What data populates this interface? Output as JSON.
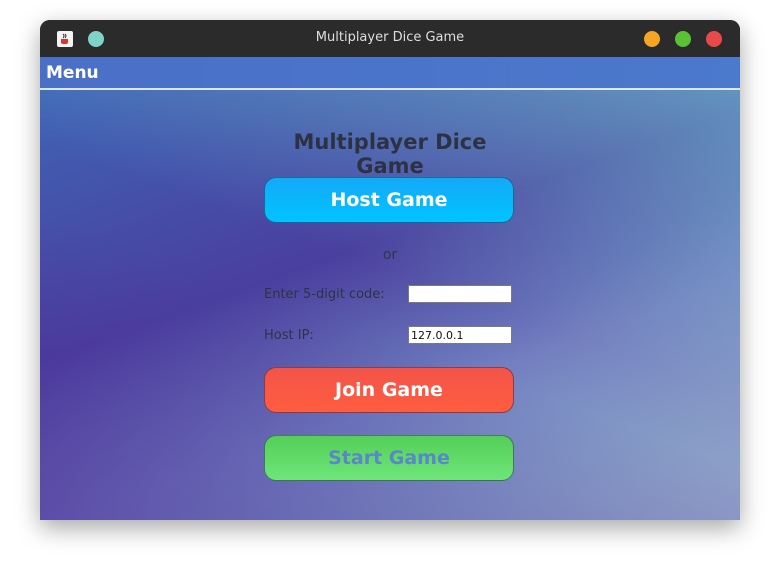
{
  "window": {
    "title": "Multiplayer Dice Game"
  },
  "menu": {
    "label": "Menu"
  },
  "main": {
    "heading": "Multiplayer Dice Game",
    "host_button": "Host Game",
    "or_text": "or",
    "code_label": "Enter 5-digit code:",
    "code_value": "",
    "ip_label": "Host IP:",
    "ip_value": "127.0.0.1",
    "join_button": "Join Game",
    "start_button": "Start Game"
  },
  "icons": {
    "app": "java-cup-icon",
    "extra": "teal-circle-icon",
    "minimize": "minimize-dot-icon",
    "maximize": "maximize-dot-icon",
    "close": "close-dot-icon"
  },
  "colors": {
    "titlebar": "#2b2b2b",
    "menubar": "#4a6fc7",
    "host": "#00c4ff",
    "join": "#ff5d3f",
    "start": "#6fe57a",
    "minimize": "#f5a623",
    "maximize": "#5bc236",
    "close": "#e84a4a"
  }
}
